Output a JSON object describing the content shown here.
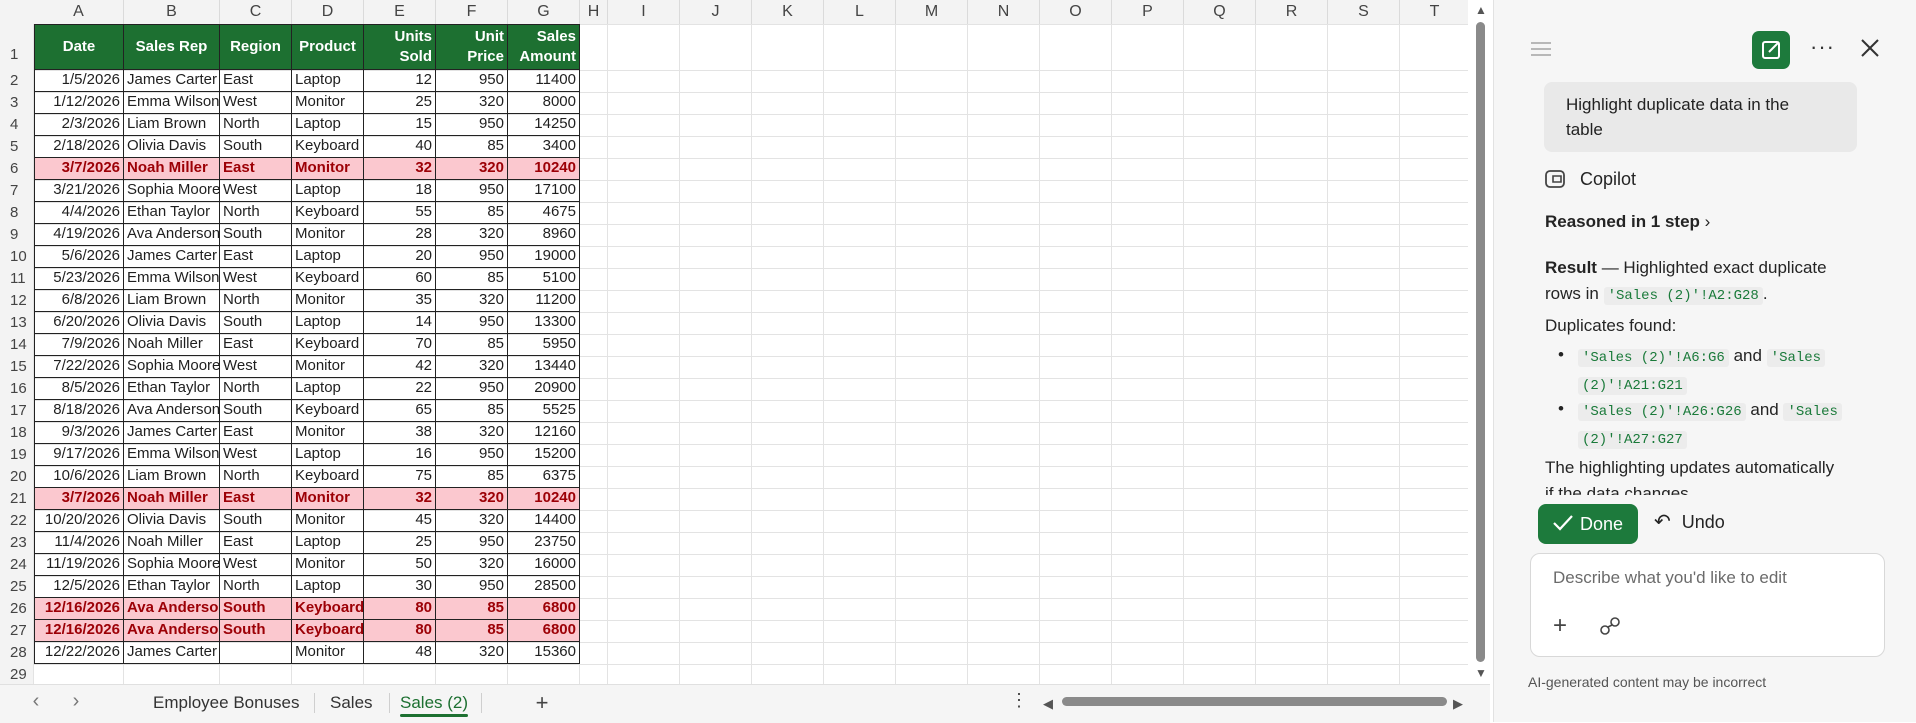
{
  "columns": [
    "A",
    "B",
    "C",
    "D",
    "E",
    "F",
    "G",
    "H",
    "I",
    "J",
    "K",
    "L",
    "M",
    "N",
    "O",
    "P",
    "Q",
    "R",
    "S",
    "T"
  ],
  "row_numbers": [
    "1",
    "2",
    "3",
    "4",
    "5",
    "6",
    "7",
    "8",
    "9",
    "10",
    "11",
    "12",
    "13",
    "14",
    "15",
    "16",
    "17",
    "18",
    "19",
    "20",
    "21",
    "22",
    "23",
    "24",
    "25",
    "26",
    "27",
    "28",
    "29"
  ],
  "table": {
    "headers": [
      "Date",
      "Sales Rep",
      "Region",
      "Product",
      "Units Sold",
      "Unit Price",
      "Sales Amount"
    ],
    "rows": [
      [
        "1/5/2026",
        "James Carter",
        "East",
        "Laptop",
        "12",
        "950",
        "11400"
      ],
      [
        "1/12/2026",
        "Emma Wilson",
        "West",
        "Monitor",
        "25",
        "320",
        "8000"
      ],
      [
        "2/3/2026",
        "Liam Brown",
        "North",
        "Laptop",
        "15",
        "950",
        "14250"
      ],
      [
        "2/18/2026",
        "Olivia Davis",
        "South",
        "Keyboard",
        "40",
        "85",
        "3400"
      ],
      [
        "3/7/2026",
        "Noah Miller",
        "East",
        "Monitor",
        "32",
        "320",
        "10240"
      ],
      [
        "3/21/2026",
        "Sophia Moore",
        "West",
        "Laptop",
        "18",
        "950",
        "17100"
      ],
      [
        "4/4/2026",
        "Ethan Taylor",
        "North",
        "Keyboard",
        "55",
        "85",
        "4675"
      ],
      [
        "4/19/2026",
        "Ava Anderson",
        "South",
        "Monitor",
        "28",
        "320",
        "8960"
      ],
      [
        "5/6/2026",
        "James Carter",
        "East",
        "Laptop",
        "20",
        "950",
        "19000"
      ],
      [
        "5/23/2026",
        "Emma Wilson",
        "West",
        "Keyboard",
        "60",
        "85",
        "5100"
      ],
      [
        "6/8/2026",
        "Liam Brown",
        "North",
        "Monitor",
        "35",
        "320",
        "11200"
      ],
      [
        "6/20/2026",
        "Olivia Davis",
        "South",
        "Laptop",
        "14",
        "950",
        "13300"
      ],
      [
        "7/9/2026",
        "Noah Miller",
        "East",
        "Keyboard",
        "70",
        "85",
        "5950"
      ],
      [
        "7/22/2026",
        "Sophia Moore",
        "West",
        "Monitor",
        "42",
        "320",
        "13440"
      ],
      [
        "8/5/2026",
        "Ethan Taylor",
        "North",
        "Laptop",
        "22",
        "950",
        "20900"
      ],
      [
        "8/18/2026",
        "Ava Anderson",
        "South",
        "Keyboard",
        "65",
        "85",
        "5525"
      ],
      [
        "9/3/2026",
        "James Carter",
        "East",
        "Monitor",
        "38",
        "320",
        "12160"
      ],
      [
        "9/17/2026",
        "Emma Wilson",
        "West",
        "Laptop",
        "16",
        "950",
        "15200"
      ],
      [
        "10/6/2026",
        "Liam Brown",
        "North",
        "Keyboard",
        "75",
        "85",
        "6375"
      ],
      [
        "3/7/2026",
        "Noah Miller",
        "East",
        "Monitor",
        "32",
        "320",
        "10240"
      ],
      [
        "10/20/2026",
        "Olivia Davis",
        "South",
        "Monitor",
        "45",
        "320",
        "14400"
      ],
      [
        "11/4/2026",
        "Noah Miller",
        "East",
        "Laptop",
        "25",
        "950",
        "23750"
      ],
      [
        "11/19/2026",
        "Sophia Moore",
        "West",
        "Monitor",
        "50",
        "320",
        "16000"
      ],
      [
        "12/5/2026",
        "Ethan Taylor",
        "North",
        "Laptop",
        "30",
        "950",
        "28500"
      ],
      [
        "12/16/2026",
        "Ava Anderson",
        "South",
        "Keyboard",
        "80",
        "85",
        "6800"
      ],
      [
        "12/16/2026",
        "Ava Anderson",
        "South",
        "Keyboard",
        "80",
        "85",
        "6800"
      ],
      [
        "12/22/2026",
        "James Carter",
        "",
        "Monitor",
        "48",
        "320",
        "15360"
      ]
    ],
    "duplicate_rows": [
      6,
      21,
      26,
      27
    ],
    "highlight_fill": "#fbc8cf",
    "highlight_text": "#9c0006",
    "header_fill": "#1d7031"
  },
  "sheet_tabs": [
    "Employee Bonuses",
    "Sales",
    "Sales (2)"
  ],
  "active_tab": "Sales (2)",
  "copilot": {
    "user_message": "Highlight duplicate data in the table",
    "assistant_name": "Copilot",
    "reasoned": "Reasoned in 1 step",
    "result_label": "Result",
    "result_text": " — Highlighted exact duplicate rows in ",
    "result_range": "'Sales (2)'!A2:G28",
    "result_end": ".",
    "dups_found": "Duplicates found:",
    "bullet1_a": "'Sales (2)'!A6:G6",
    "bullet1_and": "and",
    "bullet1_b1": "'Sales",
    "bullet1_b2": "(2)'!A21:G21",
    "bullet2_a": "'Sales (2)'!A26:G26",
    "bullet2_and": "and",
    "bullet2_b1": "'Sales",
    "bullet2_b2": "(2)'!A27:G27",
    "closing_1": "The highlighting updates automatically",
    "closing_2": "if the data changes",
    "done_label": "Done",
    "undo_label": "Undo",
    "input_placeholder": "Describe what you'd like to edit",
    "disclaimer": "AI-generated content may be incorrect"
  },
  "icons": {
    "menu": "hamburger-icon",
    "new_chat": "new-chat-icon",
    "more": "more-icon",
    "close": "close-icon",
    "copilot_logo": "copilot-icon",
    "chevron": "chevron-right-icon",
    "check": "check-icon",
    "undo": "undo-icon",
    "add": "plus-icon",
    "link": "link-icon"
  }
}
